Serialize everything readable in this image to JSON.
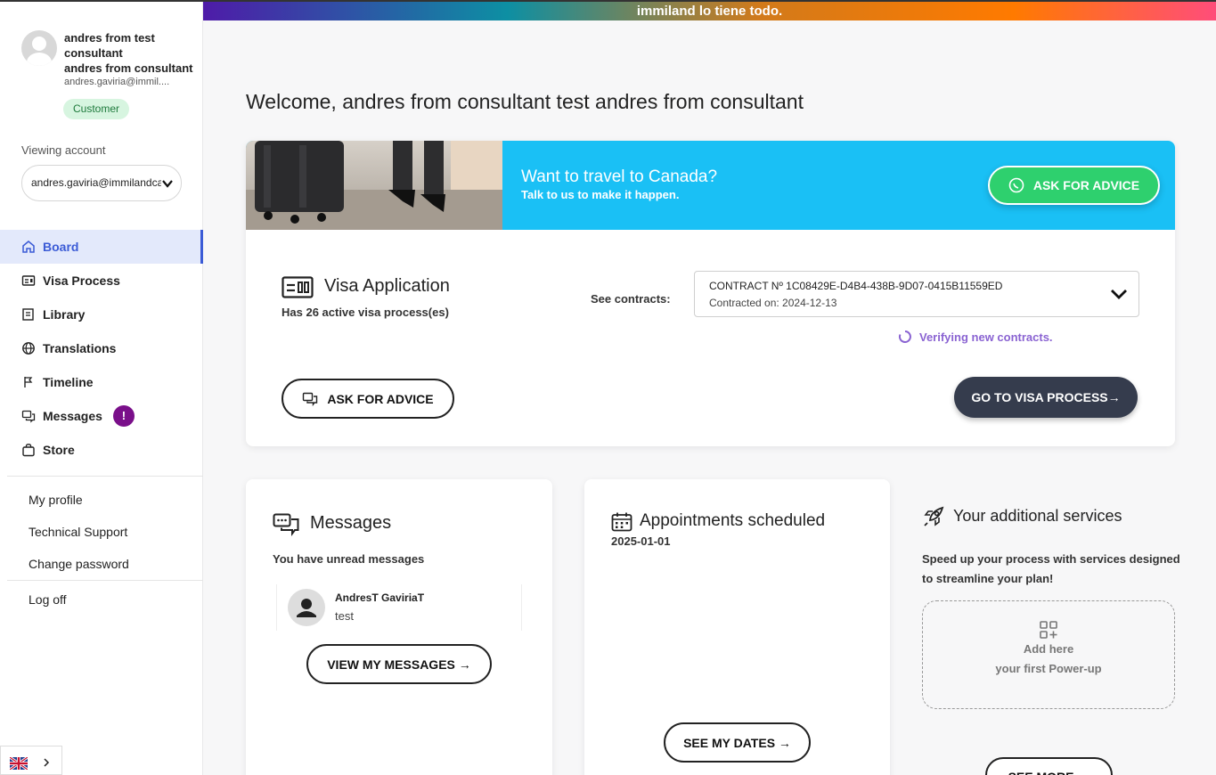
{
  "banner": {
    "text": "immiland lo tiene todo."
  },
  "user": {
    "name_line1": "andres from test",
    "name_line2": "consultant",
    "name_line3": "andres from consultant",
    "email": "andres.gaviria@immil....",
    "badge": "Customer"
  },
  "viewing": {
    "label": "Viewing account",
    "selected": "andres.gaviria@immilandcanada.com"
  },
  "nav": {
    "items": [
      {
        "label": "Board",
        "icon": "home-icon"
      },
      {
        "label": "Visa Process",
        "icon": "id-card-icon"
      },
      {
        "label": "Library",
        "icon": "book-icon"
      },
      {
        "label": "Translations",
        "icon": "globe-icon"
      },
      {
        "label": "Timeline",
        "icon": "flag-icon"
      },
      {
        "label": "Messages",
        "icon": "chat-icon",
        "badge": "!"
      },
      {
        "label": "Store",
        "icon": "bag-icon"
      }
    ]
  },
  "links": {
    "profile": "My profile",
    "support": "Technical Support",
    "password": "Change password",
    "logoff": "Log off"
  },
  "main": {
    "welcome": "Welcome, andres from consultant test andres from consultant",
    "hero": {
      "title": "Want to travel to Canada?",
      "subtitle": "Talk to us to make it happen.",
      "button": "ASK FOR ADVICE"
    },
    "visa": {
      "title": "Visa Application",
      "subtitle": "Has 26 active visa process(es)",
      "see_contracts": "See contracts:",
      "contract_line1": "CONTRACT Nº 1C08429E-D4B4-438B-9D07-0415B11559ED",
      "contract_line2": "Contracted on: 2024-12-13",
      "verifying": "Verifying new contracts.",
      "advice_button": "ASK FOR ADVICE",
      "go_button": "GO TO VISA PROCESS→"
    },
    "messages": {
      "title": "Messages",
      "subtitle": "You have unread messages",
      "author": "AndresT GaviriaT",
      "text": "test",
      "button": "VIEW MY MESSAGES →"
    },
    "appointments": {
      "title": "Appointments scheduled",
      "date": "2025-01-01",
      "button": "SEE MY DATES →"
    },
    "services": {
      "title": "Your additional services",
      "description": "Speed up your process with services designed to streamline your plan!",
      "add_line1": "Add here",
      "add_line2": "your first Power-up",
      "button": "SEE MORE →"
    }
  },
  "colors": {
    "accent": "#3b5bd6",
    "hero_bg": "#1ac0f5",
    "green": "#2ed06e",
    "dark_button": "#353c4d",
    "alert": "#7a0f8a",
    "verifying": "#8a63d2"
  }
}
